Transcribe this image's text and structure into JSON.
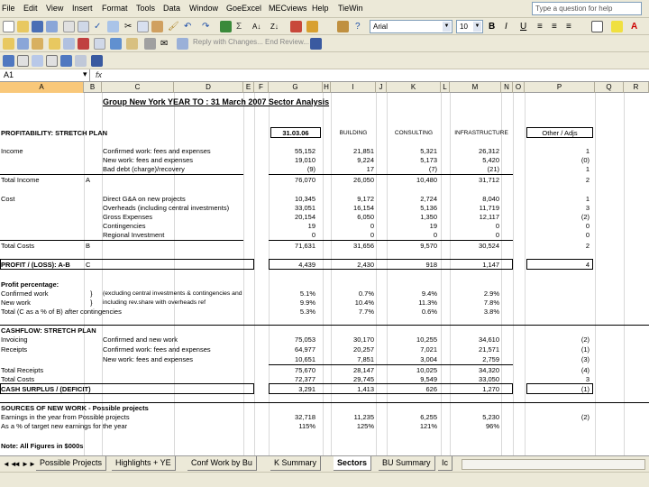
{
  "colors": {
    "chrome": "#ece9d8",
    "selected_column": "#f9c87a"
  },
  "menu": [
    "File",
    "Edit",
    "View",
    "Insert",
    "Format",
    "Tools",
    "Data",
    "Window",
    "GoeExcel",
    "MECviews",
    "Help",
    "TieWin"
  ],
  "help_placeholder": "Type a question for help",
  "font_name": "Arial",
  "font_size": "10",
  "review_text": "Reply with Changes...  End Review...",
  "name_box": "A1",
  "columns": [
    "A",
    "B",
    "C",
    "D",
    "E",
    "F",
    "G",
    "H",
    "I",
    "J",
    "K",
    "L",
    "M",
    "N",
    "O",
    "P",
    "Q",
    "R"
  ],
  "sheet": {
    "title": "Group New York YEAR TO : 31 March 2007 Sector Analysis",
    "profitability_header": "PROFITABILITY: STRETCH PLAN",
    "col_heads": {
      "date": "31.03.06",
      "building": "BUILDING",
      "consulting": "CONSULTING",
      "infra": "INFRASTRUCTURE",
      "other": "Other / Adjs"
    },
    "income_label": "Income",
    "income_rows": [
      {
        "desc": "Confirmed work: fees and expenses",
        "g": "55,152",
        "i": "21,851",
        "k": "5,321",
        "m": "26,312",
        "p": "1"
      },
      {
        "desc": "New work: fees and expenses",
        "g": "19,010",
        "i": "9,224",
        "k": "5,173",
        "m": "5,420",
        "p": "(0)"
      },
      {
        "desc": "Bad debt (charge)/recovery",
        "g": "(9)",
        "i": "17",
        "k": "(7)",
        "m": "(21)",
        "p": "1"
      }
    ],
    "total_income": {
      "label": "Total Income",
      "code": "A",
      "g": "76,070",
      "i": "26,050",
      "k": "10,480",
      "m": "31,712",
      "p": "2"
    },
    "cost_label": "Cost",
    "cost_rows": [
      {
        "desc": "Direct G&A on new projects",
        "g": "10,345",
        "i": "9,172",
        "k": "2,724",
        "m": "8,040",
        "p": "1"
      },
      {
        "desc": "Overheads (including central investments)",
        "g": "33,051",
        "i": "16,154",
        "k": "5,136",
        "m": "11,719",
        "p": "3"
      },
      {
        "desc": "Gross Expenses",
        "g": "20,154",
        "i": "6,050",
        "k": "1,350",
        "m": "12,117",
        "p": "(2)"
      },
      {
        "desc": "Contingencies",
        "g": "19",
        "i": "0",
        "k": "19",
        "m": "0",
        "p": "0"
      },
      {
        "desc": "Regional Investment",
        "g": "0",
        "i": "0",
        "k": "0",
        "m": "0",
        "p": "0"
      }
    ],
    "total_costs": {
      "label": "Total Costs",
      "code": "B",
      "g": "71,631",
      "i": "31,656",
      "k": "9,570",
      "m": "30,524",
      "p": "2"
    },
    "profit": {
      "label": "PROFIT / (LOSS): A-B",
      "code": "C",
      "g": "4,439",
      "i": "2,430",
      "k": "918",
      "m": "1,147",
      "p": "4"
    },
    "profit_pct_header": "Profit percentage:",
    "profit_pct_rows": [
      {
        "desc": "Confirmed work",
        "brace": "}",
        "note": "(excluding central investments & contingencies and",
        "g": "5.1%",
        "i": "0.7%",
        "k": "9.4%",
        "m": "2.9%"
      },
      {
        "desc": "New work",
        "brace": "}",
        "note": "including rev.share with overheads ref",
        "g": "9.9%",
        "i": "10.4%",
        "k": "11.3%",
        "m": "7.8%"
      },
      {
        "desc": "Total (C as a % of B) after contingencies",
        "brace": "",
        "note": "",
        "g": "5.3%",
        "i": "7.7%",
        "k": "0.6%",
        "m": "3.8%"
      }
    ],
    "cashflow_header": "CASHFLOW: STRETCH PLAN",
    "cash_rows": [
      {
        "desc": "Invoicing",
        "sub": "Confirmed and new work",
        "g": "75,053",
        "i": "30,170",
        "k": "10,255",
        "m": "34,610",
        "p": "(2)"
      },
      {
        "desc": "Receipts",
        "sub": "Confirmed work: fees and expenses",
        "g": "64,977",
        "i": "20,257",
        "k": "7,021",
        "m": "21,571",
        "p": "(1)"
      },
      {
        "desc": "",
        "sub": "New work: fees and expenses",
        "g": "10,651",
        "i": "7,851",
        "k": "3,004",
        "m": "2,759",
        "p": "(3)"
      },
      {
        "desc": "Total Receipts",
        "sub": "",
        "g": "75,670",
        "i": "28,147",
        "k": "10,025",
        "m": "34,320",
        "p": "(4)"
      },
      {
        "desc": "Total Costs",
        "sub": "",
        "g": "72,377",
        "i": "29,745",
        "k": "9,549",
        "m": "33,050",
        "p": "3"
      }
    ],
    "cash_surplus": {
      "label": "CASH SURPLUS / (DEFICIT)",
      "g": "3,291",
      "i": "1,413",
      "k": "626",
      "m": "1,270",
      "p": "(1)"
    },
    "sources_header": "SOURCES OF NEW WORK - Possible projects",
    "sources_rows": [
      {
        "desc": "Earnings in the year from Possible projects",
        "g": "32,718",
        "i": "11,235",
        "k": "6,255",
        "m": "5,230",
        "p": "(2)"
      },
      {
        "desc": "As a % of target new earnings for the year",
        "g": "115%",
        "i": "125%",
        "k": "121%",
        "m": "96%",
        "p": ""
      }
    ],
    "footnote": "Note: All Figures in $000s"
  },
  "tabs": {
    "nav": [
      "◄◄",
      "◄",
      "►",
      "►►"
    ],
    "items": [
      {
        "label": "Possible Projects",
        "active": false
      },
      {
        "label": "Highlights + YE",
        "active": false
      },
      {
        "label": "Conf Work by Bu",
        "active": false
      },
      {
        "label": "K Summary",
        "active": false
      },
      {
        "label": "Sectors",
        "active": true
      },
      {
        "label": "BU Summary",
        "active": false
      },
      {
        "label": "Ic",
        "active": false
      }
    ]
  }
}
